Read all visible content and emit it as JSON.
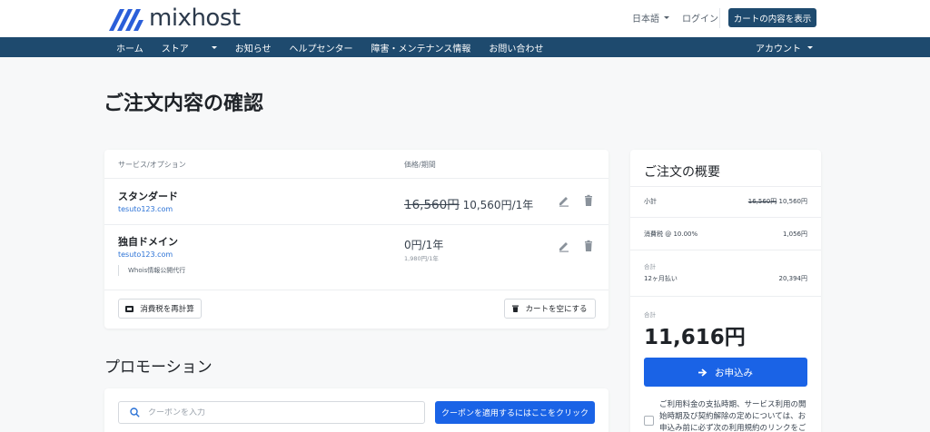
{
  "header": {
    "logo_text": "mixhost",
    "language": "日本語",
    "login": "ログイン",
    "view_cart": "カートの内容を表示"
  },
  "nav": {
    "items": [
      "ホーム",
      "ストア",
      "お知らせ",
      "ヘルプセンター",
      "障害・メンテナンス情報",
      "お問い合わせ"
    ],
    "account": "アカウント"
  },
  "page_title": "ご注文内容の確認",
  "cart": {
    "col_service": "サービス/オプション",
    "col_price": "価格/期間",
    "items": [
      {
        "name": "スタンダード",
        "domain": "tesuto123.com",
        "original_price": "16,560円",
        "price": "10,560円/1年"
      },
      {
        "name": "独自ドメイン",
        "domain": "tesuto123.com",
        "addon": "Whois情報公開代行",
        "price": "0円/1年",
        "renewal": "1,980円/1年"
      }
    ],
    "recalc_tax": "消費税を再計算",
    "empty_cart": "カートを空にする"
  },
  "promo": {
    "title": "プロモーション",
    "placeholder": "クーポンを入力",
    "apply_button": "クーポンを適用するにはここをクリック"
  },
  "summary": {
    "title": "ご注文の概要",
    "subtotal_label": "小計",
    "subtotal_original": "16,560円",
    "subtotal": "10,560円",
    "tax_label": "消費税 @ 10.00%",
    "tax": "1,056円",
    "totals_heading": "合計",
    "period_label": "12ヶ月払い",
    "period_total": "20,394円",
    "total_label": "合計",
    "total": "11,616円",
    "order_button": "お申込み",
    "terms_text": "ご利用料金の支払時期、サービス利用の開始時期及び契約解除の定めについては、お申込み前に必ず次の利用規約のリンクをご"
  },
  "colors": {
    "brand_navy": "#1e4a6e",
    "primary_blue": "#1a63e6",
    "link_blue": "#2b72d6"
  }
}
